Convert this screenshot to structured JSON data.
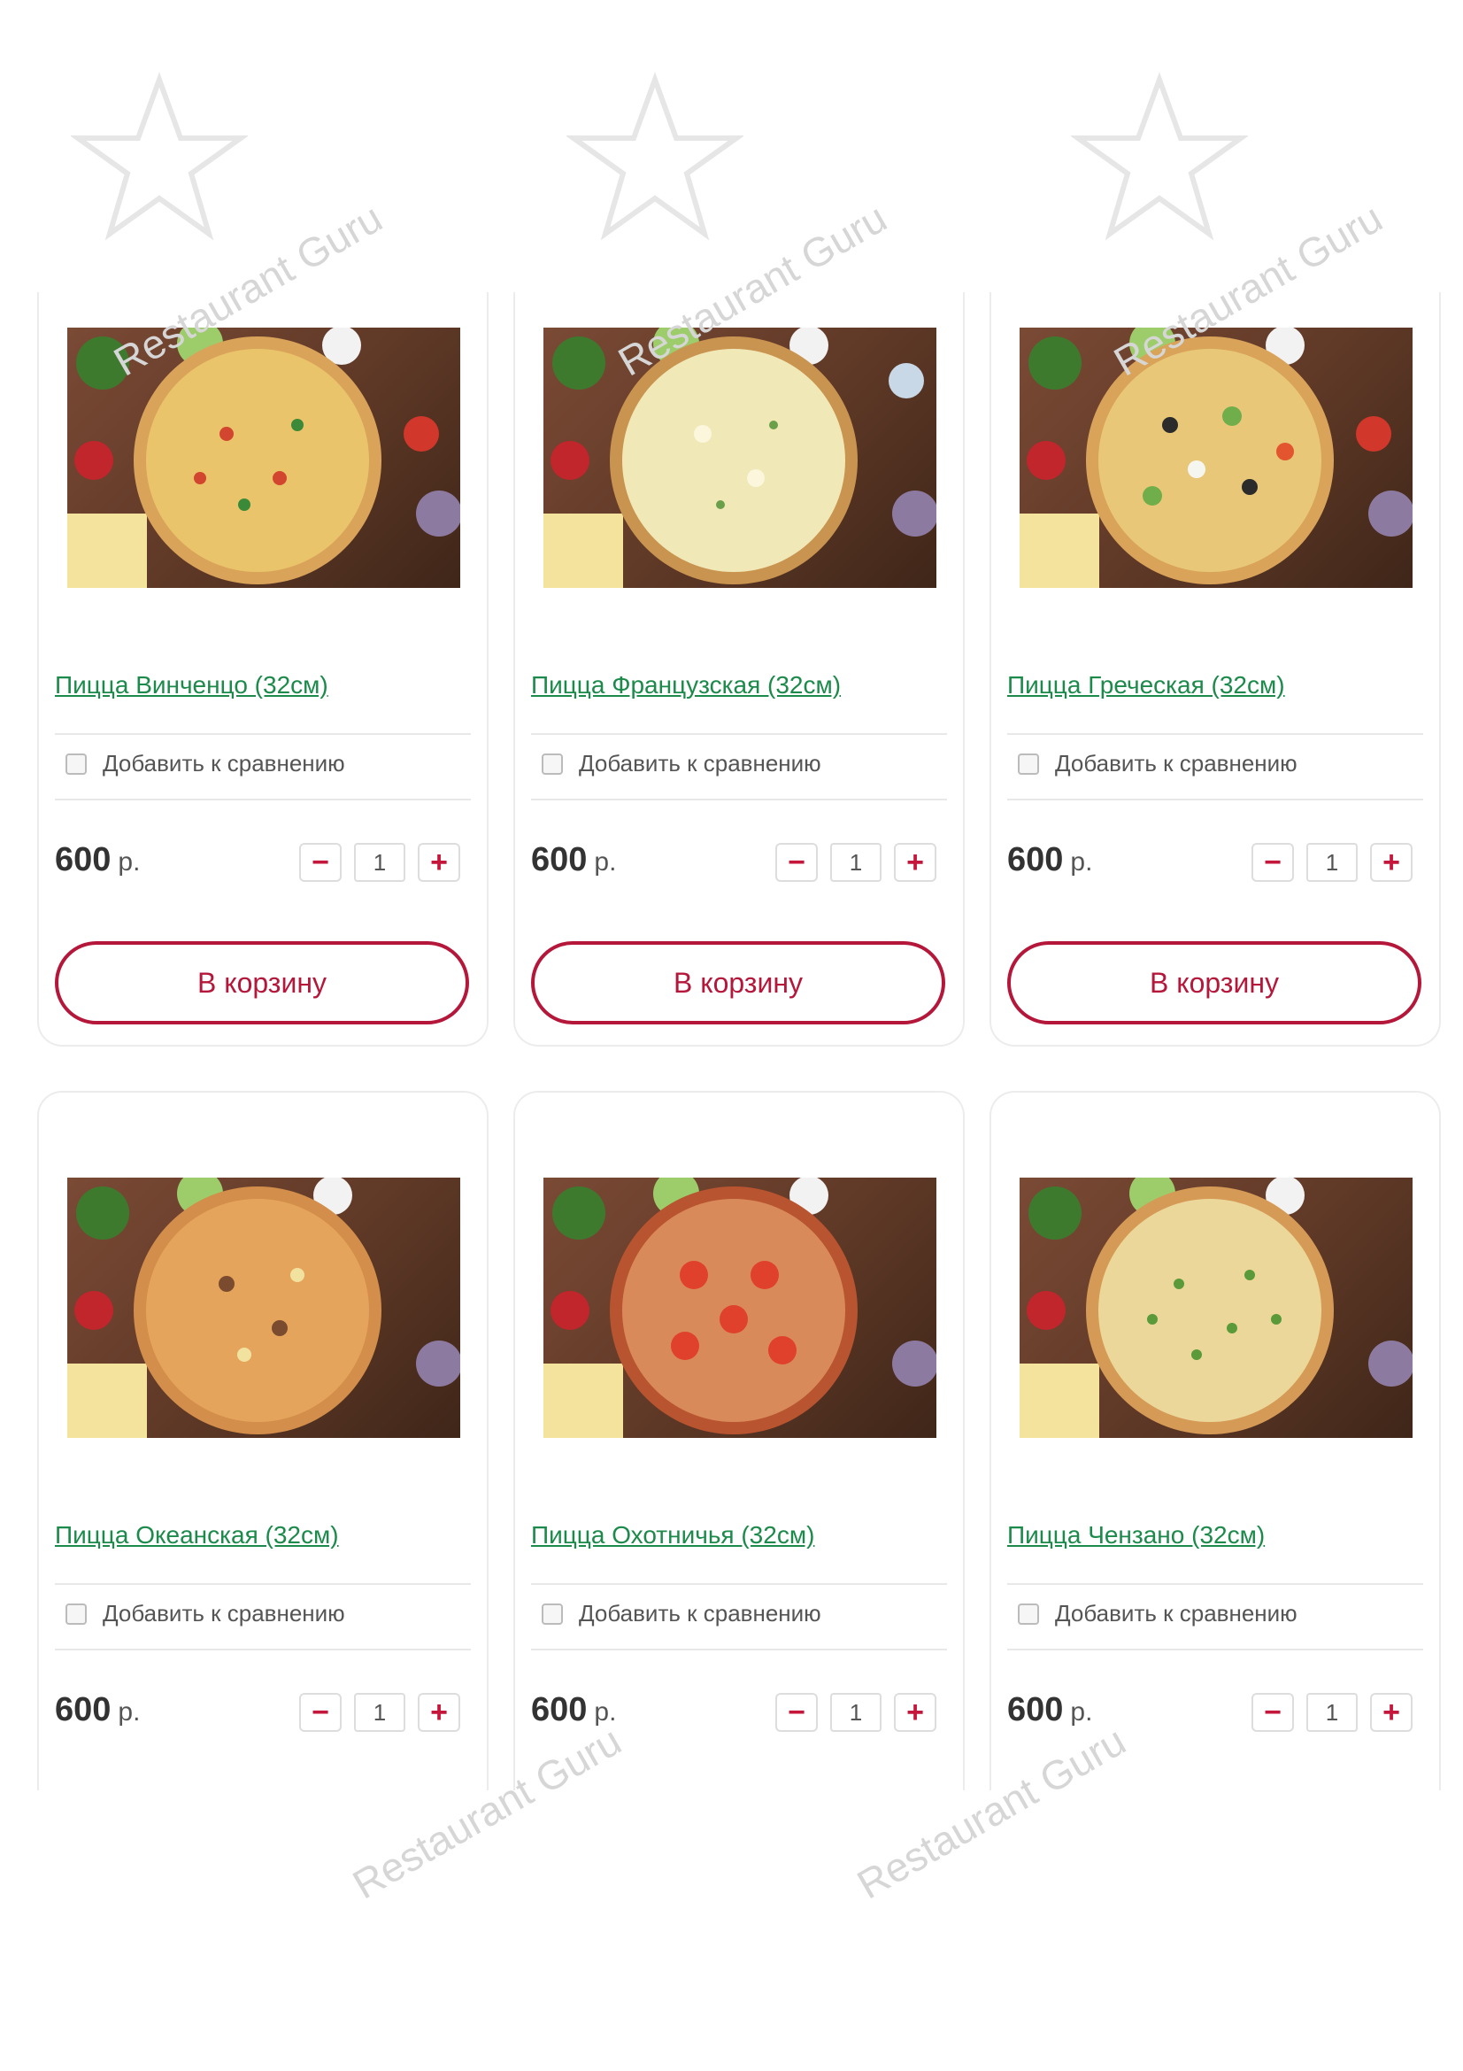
{
  "watermark": "Restaurant Guru",
  "products": [
    {
      "name": "Пицца Винченцо (32см)",
      "compare": "Добавить к сравнению",
      "price": "600",
      "currency": "р.",
      "qty": "1",
      "minus": "−",
      "plus": "+",
      "cart": "В корзину",
      "photo": "pizza-vincenzo-photo"
    },
    {
      "name": "Пицца Французская (32см)",
      "compare": "Добавить к сравнению",
      "price": "600",
      "currency": "р.",
      "qty": "1",
      "minus": "−",
      "plus": "+",
      "cart": "В корзину",
      "photo": "pizza-french-photo"
    },
    {
      "name": "Пицца Греческая (32см)",
      "compare": "Добавить к сравнению",
      "price": "600",
      "currency": "р.",
      "qty": "1",
      "minus": "−",
      "plus": "+",
      "cart": "В корзину",
      "photo": "pizza-greek-photo"
    },
    {
      "name": "Пицца Океанская (32см)",
      "compare": "Добавить к сравнению",
      "price": "600",
      "currency": "р.",
      "qty": "1",
      "minus": "−",
      "plus": "+",
      "photo": "pizza-ocean-photo"
    },
    {
      "name": "Пицца Охотничья (32см)",
      "compare": "Добавить к сравнению",
      "price": "600",
      "currency": "р.",
      "qty": "1",
      "minus": "−",
      "plus": "+",
      "photo": "pizza-hunter-photo"
    },
    {
      "name": "Пицца Чензано (32см)",
      "compare": "Добавить к сравнению",
      "price": "600",
      "currency": "р.",
      "qty": "1",
      "minus": "−",
      "plus": "+",
      "photo": "pizza-cinzano-photo"
    }
  ],
  "colors": {
    "link": "#1c8a4a",
    "accent": "#b5173a",
    "border": "#ececec"
  }
}
